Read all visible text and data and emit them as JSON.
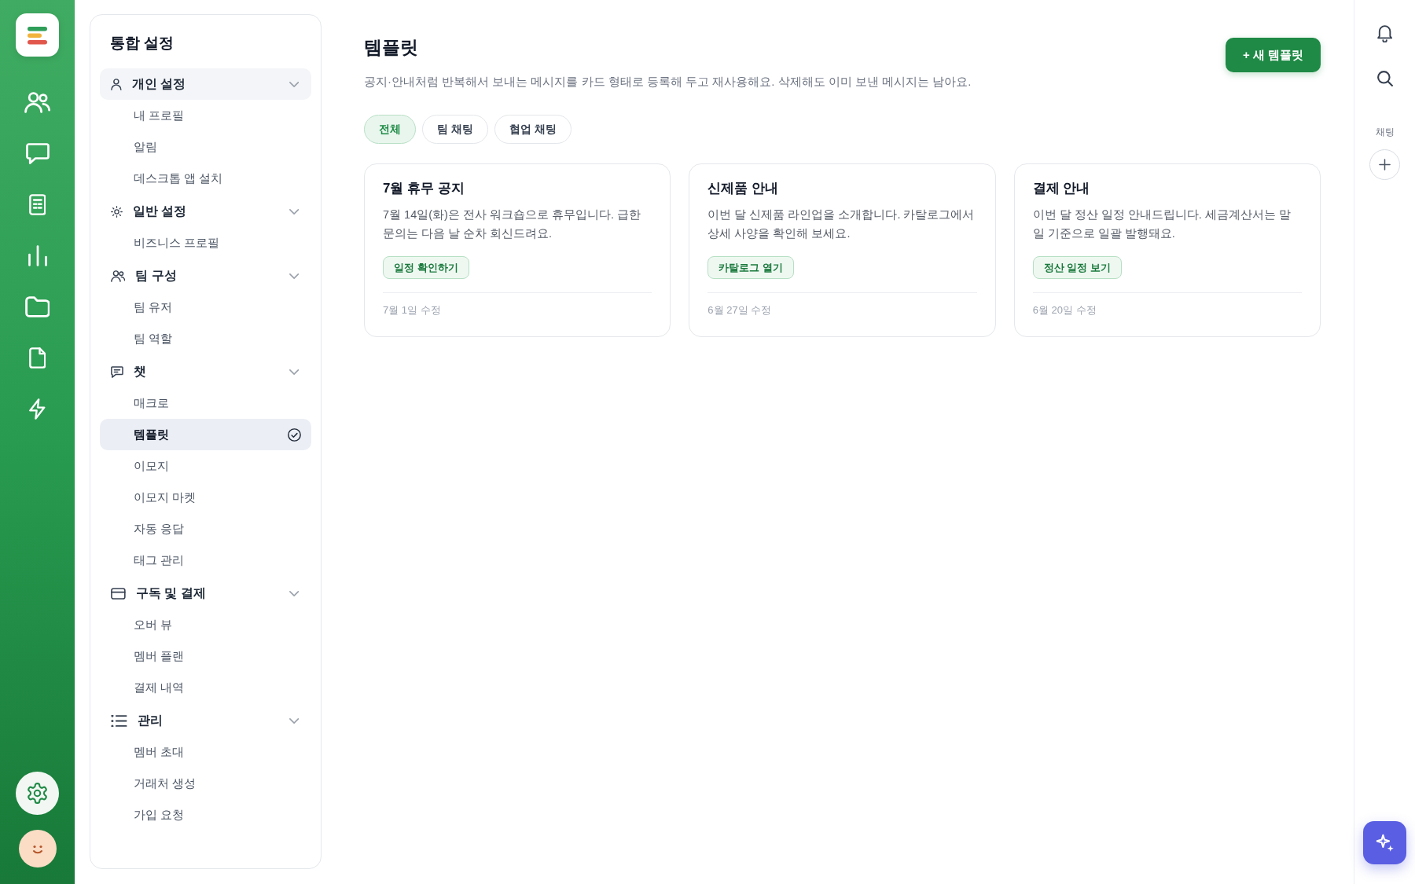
{
  "rail": {
    "items": [
      {
        "selected": false
      },
      {
        "selected": false
      },
      {
        "selected": false
      },
      {
        "selected": false
      },
      {
        "selected": false
      },
      {
        "selected": false
      },
      {
        "selected": false
      }
    ],
    "settings": {
      "selected": true
    }
  },
  "sidebar": {
    "title": "통합 설정",
    "groups": [
      {
        "label": "개인 설정",
        "highlighted": true,
        "expanded": true,
        "items": [
          {
            "label": "내 프로필",
            "selected": false
          },
          {
            "label": "알림",
            "selected": false
          },
          {
            "label": "데스크톱 앱 설치",
            "selected": false
          }
        ]
      },
      {
        "label": "일반 설정",
        "highlighted": false,
        "expanded": true,
        "items": [
          {
            "label": "비즈니스 프로필",
            "selected": false
          }
        ]
      },
      {
        "label": "팀 구성",
        "highlighted": false,
        "expanded": true,
        "items": [
          {
            "label": "팀 유저",
            "selected": false
          },
          {
            "label": "팀 역할",
            "selected": false
          }
        ]
      },
      {
        "label": "챗",
        "highlighted": false,
        "expanded": true,
        "items": [
          {
            "label": "매크로",
            "selected": false
          },
          {
            "label": "템플릿",
            "selected": true
          },
          {
            "label": "이모지",
            "selected": false
          },
          {
            "label": "이모지 마켓",
            "selected": false
          },
          {
            "label": "자동 응답",
            "selected": false
          },
          {
            "label": "태그 관리",
            "selected": false
          }
        ]
      },
      {
        "label": "구독 및 결제",
        "highlighted": false,
        "expanded": true,
        "items": [
          {
            "label": "오버 뷰",
            "selected": false
          },
          {
            "label": "멤버 플랜",
            "selected": false
          },
          {
            "label": "결제 내역",
            "selected": false
          }
        ]
      },
      {
        "label": "관리",
        "highlighted": false,
        "expanded": true,
        "items": [
          {
            "label": "멤버 초대",
            "selected": false
          },
          {
            "label": "거래처 생성",
            "selected": false
          },
          {
            "label": "가입 요청",
            "selected": false
          }
        ]
      }
    ]
  },
  "page": {
    "title": "템플릿",
    "description": "공지·안내처럼 반복해서 보내는 메시지를 카드 형태로 등록해 두고 재사용해요. 삭제해도 이미 보낸 메시지는 남아요.",
    "new_button": "+ 새 템플릿",
    "tabs": [
      {
        "label": "전체",
        "selected": true
      },
      {
        "label": "팀 채팅",
        "selected": false
      },
      {
        "label": "협업 채팅",
        "selected": false
      }
    ],
    "cards": [
      {
        "title": "7월 휴무 공지",
        "body": "7월 14일(화)은 전사 워크숍으로 휴무입니다. 급한 문의는 다음 날 순차 회신드려요.",
        "action": "일정 확인하기",
        "updated": "7월 1일 수정"
      },
      {
        "title": "신제품 안내",
        "body": "이번 달 신제품 라인업을 소개합니다. 카탈로그에서 상세 사양을 확인해 보세요.",
        "action": "카탈로그 열기",
        "updated": "6월 27일 수정"
      },
      {
        "title": "결제 안내",
        "body": "이번 달 정산 일정 안내드립니다. 세금계산서는 말일 기준으로 일괄 발행돼요.",
        "action": "정산 일정 보기",
        "updated": "6월 20일 수정"
      }
    ]
  },
  "right_rail": {
    "section_label": "채팅"
  }
}
